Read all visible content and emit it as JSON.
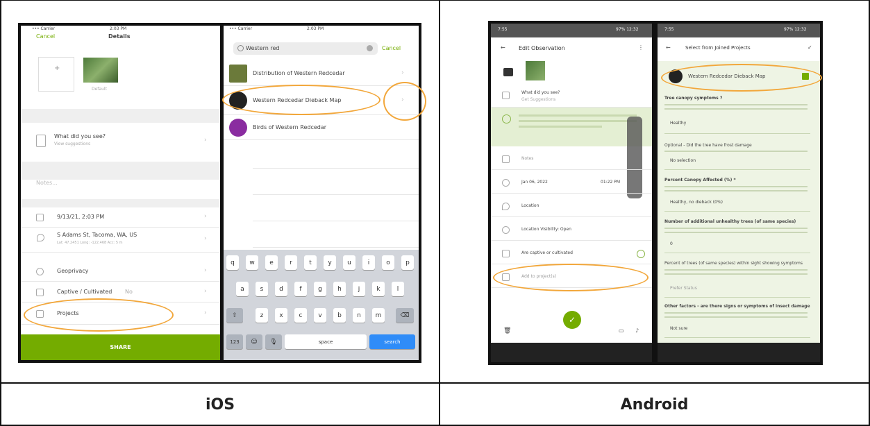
{
  "captions": {
    "left": "iOS",
    "right": "Android"
  },
  "ios_details": {
    "status_left": "••• Carrier",
    "status_time": "2:03 PM",
    "cancel": "Cancel",
    "title": "Details",
    "photo_caption": "Default",
    "what_label": "What did you see?",
    "what_sub": "View suggestions",
    "notes": "Notes...",
    "datetime": "9/13/21, 2:03 PM",
    "location": "S Adams St, Tacoma, WA, US",
    "location_sub": "Lat: 47.2451 Long: -122.468 Acc: 5 m",
    "geoprivacy": "Geoprivacy",
    "captive": "Captive / Cultivated",
    "captive_value": "No",
    "projects": "Projects",
    "share": "SHARE"
  },
  "ios_search": {
    "status_left": "••• Carrier",
    "status_time": "2:03 PM",
    "query": "Western red",
    "cancel": "Cancel",
    "results": [
      {
        "label": "Distribution of Western Redcedar",
        "color": "#6b7a3a"
      },
      {
        "label": "Western Redcedar Dieback Map",
        "color": "#222222"
      },
      {
        "label": "Birds of Western Redcedar",
        "color": "#8a2ca0"
      }
    ],
    "keyboard": {
      "row1": [
        "q",
        "w",
        "e",
        "r",
        "t",
        "y",
        "u",
        "i",
        "o",
        "p"
      ],
      "row2": [
        "a",
        "s",
        "d",
        "f",
        "g",
        "h",
        "j",
        "k",
        "l"
      ],
      "row3": [
        "z",
        "x",
        "c",
        "v",
        "b",
        "n",
        "m"
      ],
      "num": "123",
      "space": "space",
      "search": "search"
    }
  },
  "android_edit": {
    "status_left": "7:55",
    "status_right": "97% 12:32",
    "title": "Edit Observation",
    "what_label": "What did you see?",
    "what_sub": "Get Suggestions",
    "notes": "Notes",
    "date": "Jan 06, 2022",
    "time": "01:22 PM",
    "location": "Location",
    "visibility": "Location Visibility: Open",
    "captive": "Are captive or cultivated",
    "projects": "Add to project(s)"
  },
  "android_projects": {
    "status_left": "7:55",
    "status_right": "97% 12:32",
    "title": "Select from Joined Projects",
    "project": "Western Redcedar Dieback Map",
    "fields": [
      {
        "q": "Tree canopy symptoms ?",
        "a": "Healthy"
      },
      {
        "q": "Optional - Did the tree have frost damage",
        "a": "No selection"
      },
      {
        "q": "Percent Canopy Affected (%) *",
        "a": "Healthy, no dieback (0%)"
      },
      {
        "q": "Number of additional unhealthy trees (of same species)",
        "a": "0"
      },
      {
        "q": "Percent of trees (of same species) within sight showing symptoms",
        "a": "Prefer Status"
      },
      {
        "q": "Other factors - are there signs or symptoms of insect damage",
        "a": "Not sure"
      }
    ]
  },
  "colors": {
    "ios_green": "#74ac00",
    "highlight": "#f2a73b",
    "ios_blue": "#2f8cf8",
    "android_green": "#eef4e4"
  }
}
